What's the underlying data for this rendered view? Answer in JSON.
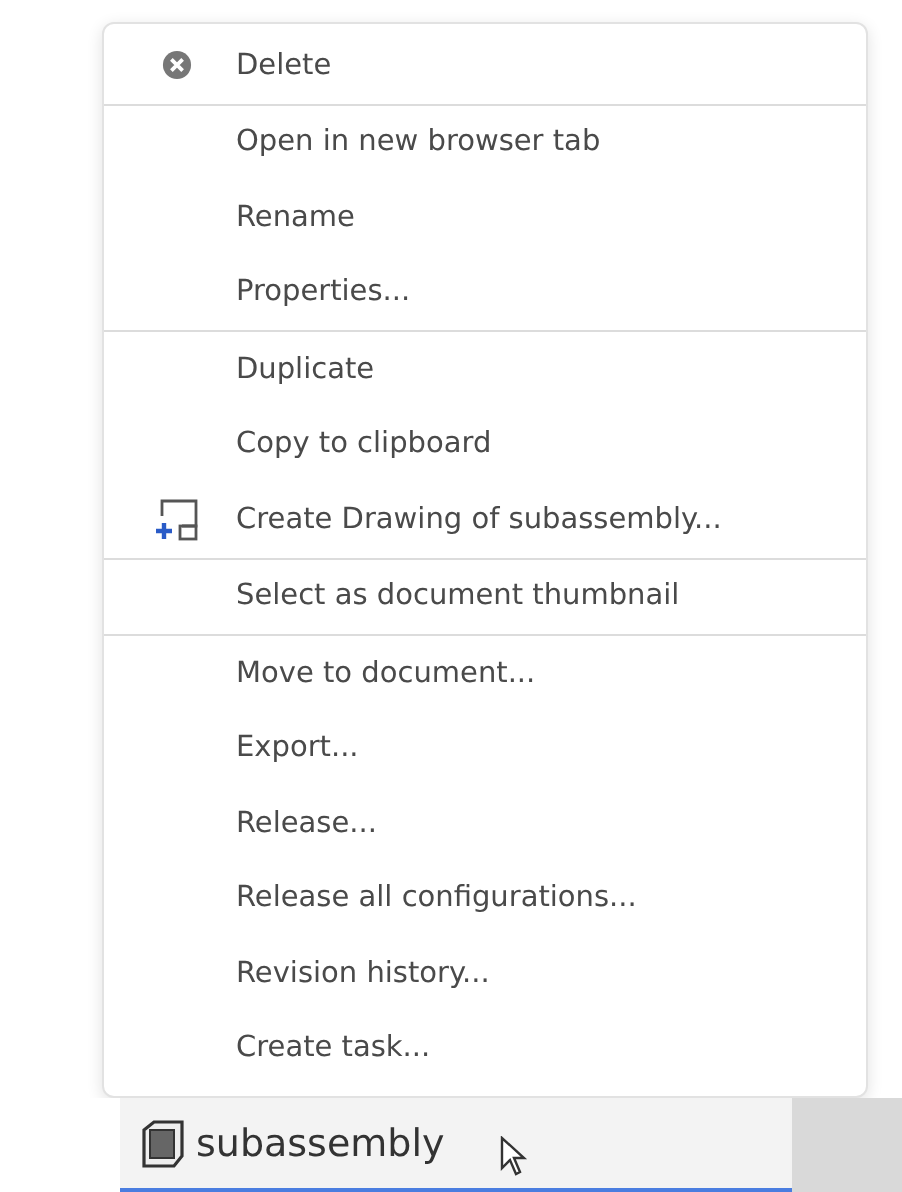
{
  "context_menu": {
    "groups": [
      {
        "items": [
          {
            "label": "Delete",
            "kind": "delete"
          }
        ]
      },
      {
        "items": [
          {
            "label": "Open in new browser tab",
            "kind": "plain"
          },
          {
            "label": "Rename",
            "kind": "plain"
          },
          {
            "label": "Properties...",
            "kind": "plain"
          }
        ]
      },
      {
        "items": [
          {
            "label": "Duplicate",
            "kind": "plain"
          },
          {
            "label": "Copy to clipboard",
            "kind": "plain"
          },
          {
            "label": "Create Drawing of subassembly...",
            "kind": "drawing"
          }
        ]
      },
      {
        "items": [
          {
            "label": "Select as document thumbnail",
            "kind": "plain"
          }
        ]
      },
      {
        "items": [
          {
            "label": "Move to document...",
            "kind": "plain"
          },
          {
            "label": "Export...",
            "kind": "plain"
          },
          {
            "label": "Release...",
            "kind": "plain"
          },
          {
            "label": "Release all configurations...",
            "kind": "plain"
          },
          {
            "label": "Revision history...",
            "kind": "plain"
          },
          {
            "label": "Create task...",
            "kind": "plain"
          }
        ]
      }
    ]
  },
  "tab": {
    "label": "subassembly",
    "selected": true
  }
}
